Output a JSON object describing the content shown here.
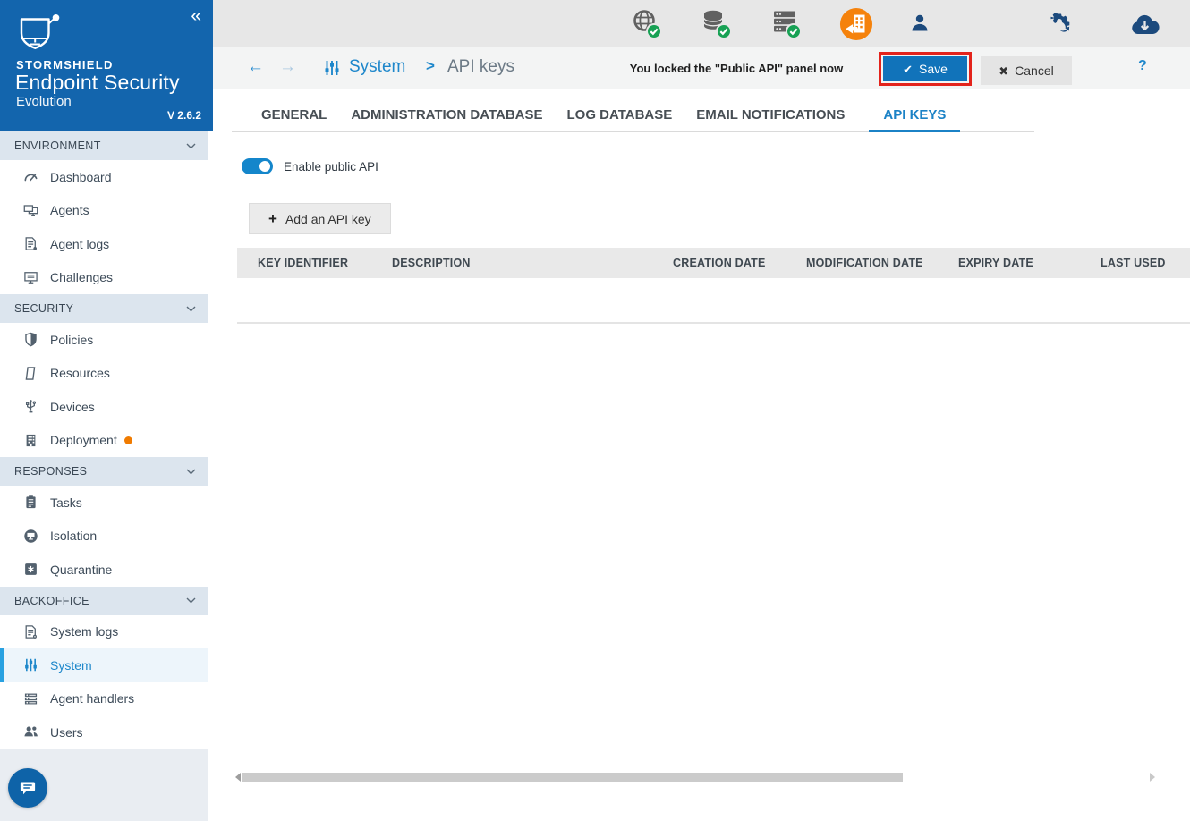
{
  "branding": {
    "brand": "STORMSHIELD",
    "product": "Endpoint Security",
    "edition": "Evolution",
    "version": "V 2.6.2",
    "collapse_icon": "«"
  },
  "sidebar": {
    "sections": [
      {
        "label": "ENVIRONMENT",
        "items": [
          {
            "label": "Dashboard",
            "icon": "dashboard"
          },
          {
            "label": "Agents",
            "icon": "agents"
          },
          {
            "label": "Agent logs",
            "icon": "agent-logs"
          },
          {
            "label": "Challenges",
            "icon": "challenges"
          }
        ]
      },
      {
        "label": "SECURITY",
        "items": [
          {
            "label": "Policies",
            "icon": "policies"
          },
          {
            "label": "Resources",
            "icon": "resources"
          },
          {
            "label": "Devices",
            "icon": "devices"
          },
          {
            "label": "Deployment",
            "icon": "deployment",
            "badge_dot": true
          }
        ]
      },
      {
        "label": "RESPONSES",
        "items": [
          {
            "label": "Tasks",
            "icon": "tasks"
          },
          {
            "label": "Isolation",
            "icon": "isolation"
          },
          {
            "label": "Quarantine",
            "icon": "quarantine"
          }
        ]
      },
      {
        "label": "BACKOFFICE",
        "items": [
          {
            "label": "System logs",
            "icon": "system-logs"
          },
          {
            "label": "System",
            "icon": "system",
            "active": true
          },
          {
            "label": "Agent handlers",
            "icon": "agent-handlers"
          },
          {
            "label": "Users",
            "icon": "users"
          }
        ]
      }
    ]
  },
  "topbar": {
    "status_icons": [
      {
        "name": "internet-status",
        "state": "ok"
      },
      {
        "name": "database-status",
        "state": "ok"
      },
      {
        "name": "agent-handler-status",
        "state": "ok"
      },
      {
        "name": "deployment-pending-status",
        "state": "attention"
      }
    ],
    "right_icons": [
      {
        "name": "user-account"
      },
      {
        "name": "services"
      },
      {
        "name": "cloud-download"
      }
    ]
  },
  "actionbar": {
    "back_icon": "←",
    "forward_icon": "→",
    "breadcrumb": {
      "parent": "System",
      "separator": ">",
      "current": "API keys"
    },
    "notification": "You locked the \"Public API\" panel now",
    "save_label": "Save",
    "save_glyph": "✔",
    "cancel_label": "Cancel",
    "cancel_glyph": "✖",
    "help_label": "?"
  },
  "tabs": [
    {
      "label": "GENERAL"
    },
    {
      "label": "ADMINISTRATION DATABASE"
    },
    {
      "label": "LOG DATABASE"
    },
    {
      "label": "EMAIL NOTIFICATIONS"
    },
    {
      "label": "API KEYS",
      "active": true
    }
  ],
  "panel": {
    "toggle_label": "Enable public API",
    "toggle_state": "on",
    "add_key_label": "Add an API key",
    "add_icon": "+"
  },
  "api_keys_table": {
    "columns": [
      "KEY IDENTIFIER",
      "DESCRIPTION",
      "CREATION DATE",
      "MODIFICATION DATE",
      "EXPIRY DATE",
      "LAST USED"
    ],
    "rows": []
  },
  "colors": {
    "sidebar_blue": "#1365ad",
    "accent_blue": "#1b82c6",
    "active_item_bar": "#29a1e1",
    "save_button_blue": "#1173ba",
    "annotation_red": "#e3231b",
    "status_green": "#17a154",
    "alert_orange": "#f5820c",
    "navy_icon": "#1c4a7d",
    "toggle_blue": "#1486cb"
  }
}
